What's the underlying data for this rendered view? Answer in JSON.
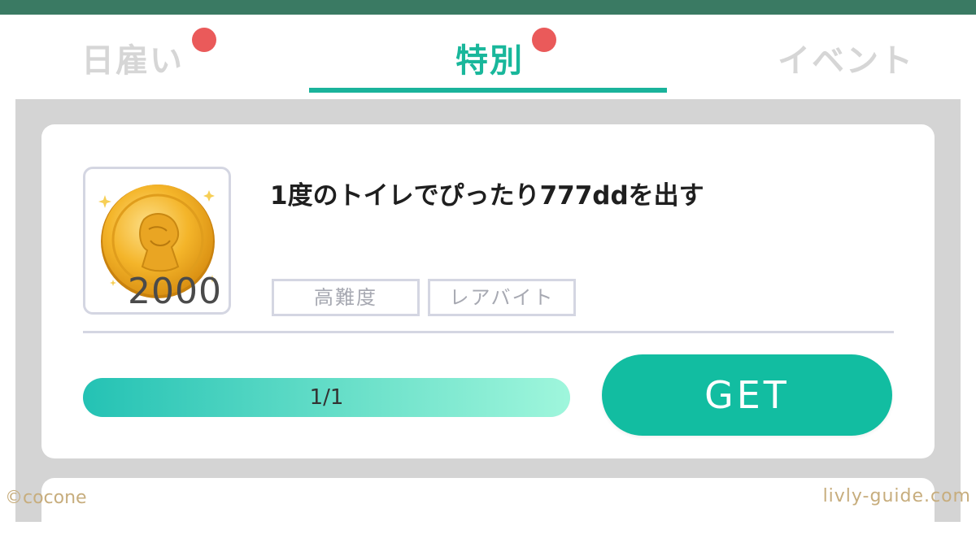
{
  "tabs": [
    {
      "label": "日雇い",
      "has_badge": true
    },
    {
      "label": "特別",
      "has_badge": true,
      "active": true
    },
    {
      "label": "イベント",
      "has_badge": false
    }
  ],
  "mission": {
    "title": "1度のトイレでぴったり777ddを出す",
    "reward_icon": "gold-coin-icon",
    "reward_amount": "2000",
    "tags": [
      "高難度",
      "レアバイト"
    ],
    "progress_text": "1/1",
    "progress_fraction": 1.0,
    "button_label": "GET"
  },
  "colors": {
    "accent": "#12bda1",
    "header_bar": "#3a7a63",
    "badge": "#ea5a5a",
    "inactive_tab": "#d6d6d6"
  },
  "watermarks": {
    "left": "©cocone",
    "right": "livly-guide.com"
  }
}
